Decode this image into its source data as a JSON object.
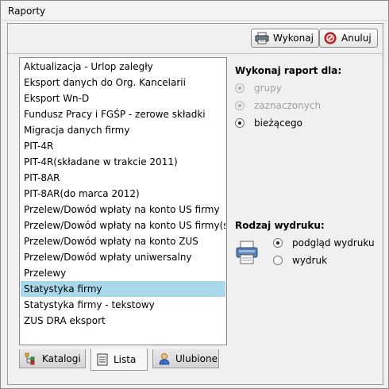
{
  "window": {
    "title": "Raporty"
  },
  "toolbar": {
    "run_label": "Wykonaj",
    "cancel_label": "Anuluj"
  },
  "report_list": {
    "items": [
      "Aktualizacja - Urlop zaległy",
      "Eksport danych do Org. Kancelarii",
      "Eksport Wn-D",
      "Fundusz Pracy i FGŚP - zerowe składki",
      "Migracja danych firmy",
      "PIT-4R",
      "PIT-4R(składane w trakcie 2011)",
      "PIT-8AR",
      "PIT-8AR(do marca 2012)",
      "Przelew/Dowód wpłaty na konto US firmy",
      "Przelew/Dowód wpłaty na konto US firmy(st.)",
      "Przelew/Dowód wpłaty na konto ZUS",
      "Przelew/Dowód wpłaty uniwersalny",
      "Przelewy",
      "Statystyka firmy",
      "Statystyka firmy - tekstowy",
      "ZUS DRA eksport"
    ],
    "selected_index": 14
  },
  "tabs": {
    "catalogs": "Katalogi",
    "list": "Lista",
    "favorites": "Ulubione",
    "active": "Lista"
  },
  "run_for": {
    "title": "Wykonaj raport dla:",
    "options": [
      "grupy",
      "zaznaczonych",
      "bieżącego"
    ],
    "selected": "bieżącego"
  },
  "print_type": {
    "title": "Rodzaj wydruku:",
    "options": [
      "podgląd wydruku",
      "wydruk"
    ],
    "selected": "podgląd wydruku"
  },
  "colors": {
    "selection": "#a8d8ea",
    "cancel_icon": "#cc2222"
  },
  "icons": {
    "run": "printer-icon",
    "cancel": "cancel-icon",
    "catalogs": "catalog-tree-icon",
    "list": "list-icon",
    "favorites": "favorites-user-icon",
    "print_preview": "printer-preview-icon"
  }
}
